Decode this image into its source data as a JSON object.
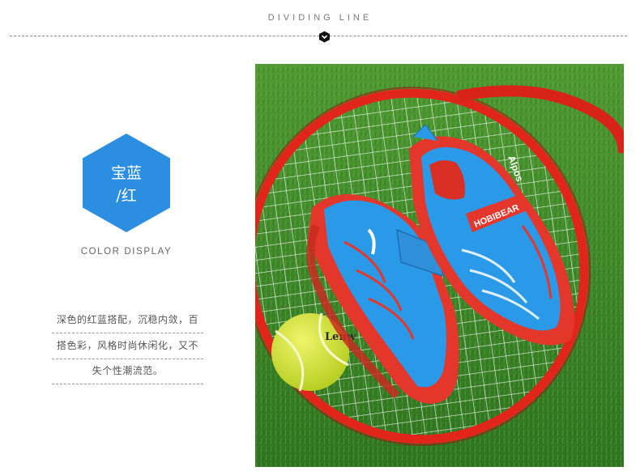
{
  "header": {
    "title": "DIVIDING LINE"
  },
  "icons": {
    "divider": "chevron-down-badge-icon"
  },
  "color_badge": {
    "line1": "宝蓝",
    "line2": "/红",
    "color": "#2b8ee0"
  },
  "color_display_label": "COLOR DISPLAY",
  "description": [
    "深色的红蓝搭配，沉稳内敛，百",
    "搭色彩，风格时尚休闲化，又不",
    "失个性潮流范。"
  ],
  "photo": {
    "subject": "blue-red-kids-sneakers-on-tennis-racket",
    "shoe_brand_text": "HOBIBEAR",
    "racket_brand_text": "Alpos",
    "ball_brand_text": "Lenw",
    "colors": {
      "grass": "#3f8a2a",
      "shoe_blue": "#2a9ae8",
      "shoe_red": "#e3372c",
      "racket_red": "#e1251b",
      "ball": "#d4e838"
    }
  }
}
